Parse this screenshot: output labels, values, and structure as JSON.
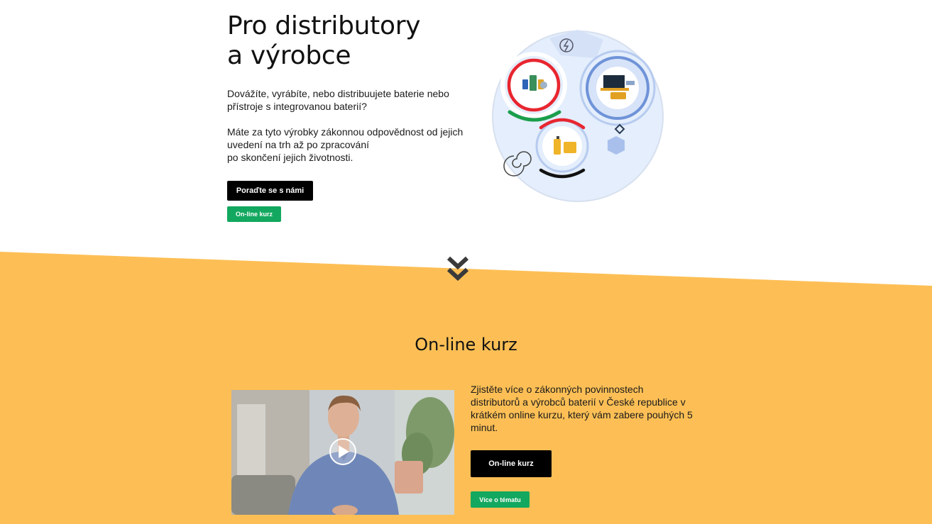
{
  "hero": {
    "title_line1": "Pro distributory",
    "title_line2": "a výrobce",
    "paragraph1": "Dovážíte, vyrábíte, nebo distribuujete baterie nebo přístroje s integrovanou baterií?",
    "paragraph2_line1": "Máte za tyto výrobky zákonnou odpovědnost od jejich uvedení na trh až po zpracování",
    "paragraph2_line2": "po skončení jejich životnosti.",
    "primary_button": "Poraďte se s námi",
    "secondary_button": "On-line kurz"
  },
  "course": {
    "title": "On-line kurz",
    "description": "Zjistěte více o zákonných povinnostech distributorů a výrobců baterií v České republice v krátkém online kurzu, který vám zabere pouhých 5 minut.",
    "primary_button": "On-line kurz",
    "secondary_button": "Více o tématu"
  },
  "colors": {
    "band": "#fdbf55",
    "green": "#13a85f",
    "black": "#000000"
  },
  "icons": {
    "scroll": "double-chevron-down-icon",
    "video": "play-icon"
  }
}
